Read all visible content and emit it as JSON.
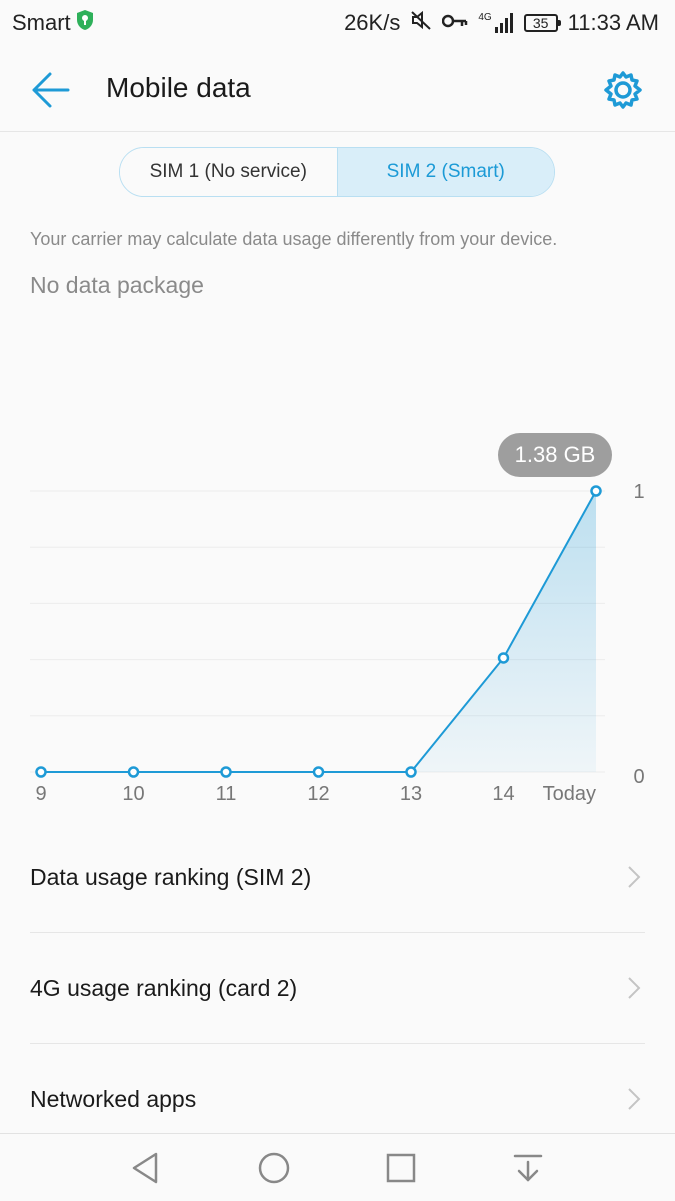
{
  "status_bar": {
    "carrier": "Smart",
    "net_speed": "26K/s",
    "network_type": "4G",
    "battery": "35",
    "time": "11:33 AM",
    "icons": [
      "vpn-shield-icon",
      "mute-icon",
      "key-icon",
      "signal-icon",
      "battery-icon"
    ]
  },
  "app_bar": {
    "title": "Mobile data",
    "back_icon": "back-arrow-icon",
    "settings_icon": "gear-icon"
  },
  "sim_tabs": [
    {
      "label": "SIM 1 (No service)",
      "selected": false
    },
    {
      "label": "SIM 2 (Smart)",
      "selected": true
    }
  ],
  "carrier_note": "Your carrier may calculate data usage differently from your device.",
  "package_status": "No data package",
  "chart_data": {
    "type": "area",
    "categories": [
      "9",
      "10",
      "11",
      "12",
      "13",
      "14",
      "Today"
    ],
    "values": [
      0,
      0,
      0,
      0,
      0,
      0.56,
      1.38
    ],
    "ylim": [
      0,
      1.38
    ],
    "y_tick_labels": [
      "0",
      "1"
    ],
    "callout": "1.38 GB",
    "grid": true,
    "color": "#1e9ad6"
  },
  "list_items": [
    {
      "label": "Data usage ranking (SIM 2)"
    },
    {
      "label": "4G usage ranking (card 2)"
    },
    {
      "label": "Networked apps"
    }
  ],
  "nav_bar": {
    "icons": [
      "nav-back-icon",
      "nav-home-icon",
      "nav-recents-icon",
      "nav-notifications-icon"
    ]
  }
}
